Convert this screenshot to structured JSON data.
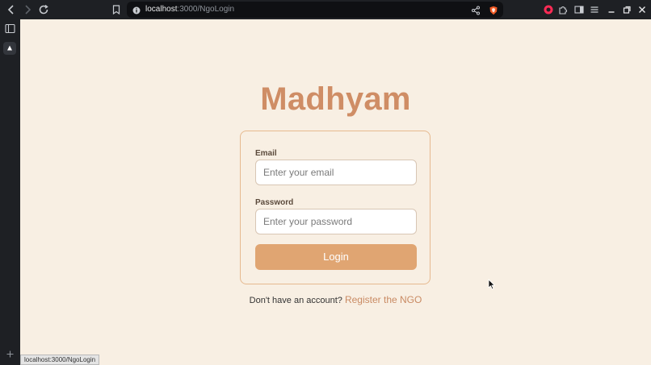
{
  "browser": {
    "url_host": "localhost",
    "url_path": ":3000/NgoLogin",
    "status_url": "localhost:3000/NgoLogin"
  },
  "page": {
    "brand": "Madhyam",
    "email_label": "Email",
    "email_placeholder": "Enter your email",
    "email_value": "",
    "password_label": "Password",
    "password_placeholder": "Enter your password",
    "password_value": "",
    "login_label": "Login",
    "register_prompt": "Don't have an account?",
    "register_link": "Register the NGO"
  },
  "colors": {
    "page_bg": "#f8efe3",
    "brand": "#cf8d65",
    "button": "#e0a572",
    "card_border": "#e6b98f",
    "link": "#c98a63"
  }
}
